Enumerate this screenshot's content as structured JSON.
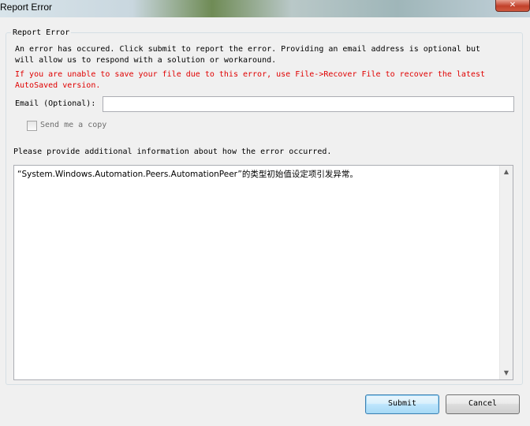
{
  "window": {
    "title": "Report Error",
    "close_glyph": "✕"
  },
  "group": {
    "legend": "Report Error",
    "intro": "An error has occured. Click submit to report the error. Providing an email address is optional but\nwill allow us to respond with a solution or workaround.",
    "warning": "If you are unable to save your file due to this error, use File->Recover File to recover the latest\nAutoSaved version.",
    "email_label": "Email (Optional):",
    "email_value": "",
    "send_copy_label": "Send me a copy",
    "send_copy_checked": false,
    "info_label": "Please provide additional information about how the error occurred.",
    "details_text": "“System.Windows.Automation.Peers.AutomationPeer”的类型初始值设定项引发异常。"
  },
  "scrollbar": {
    "up_glyph": "▲",
    "down_glyph": "▼"
  },
  "buttons": {
    "submit": "Submit",
    "cancel": "Cancel"
  },
  "colors": {
    "warning": "#e00000",
    "dialog_bg": "#f0f0f0",
    "default_button_border": "#3c7fb1"
  }
}
